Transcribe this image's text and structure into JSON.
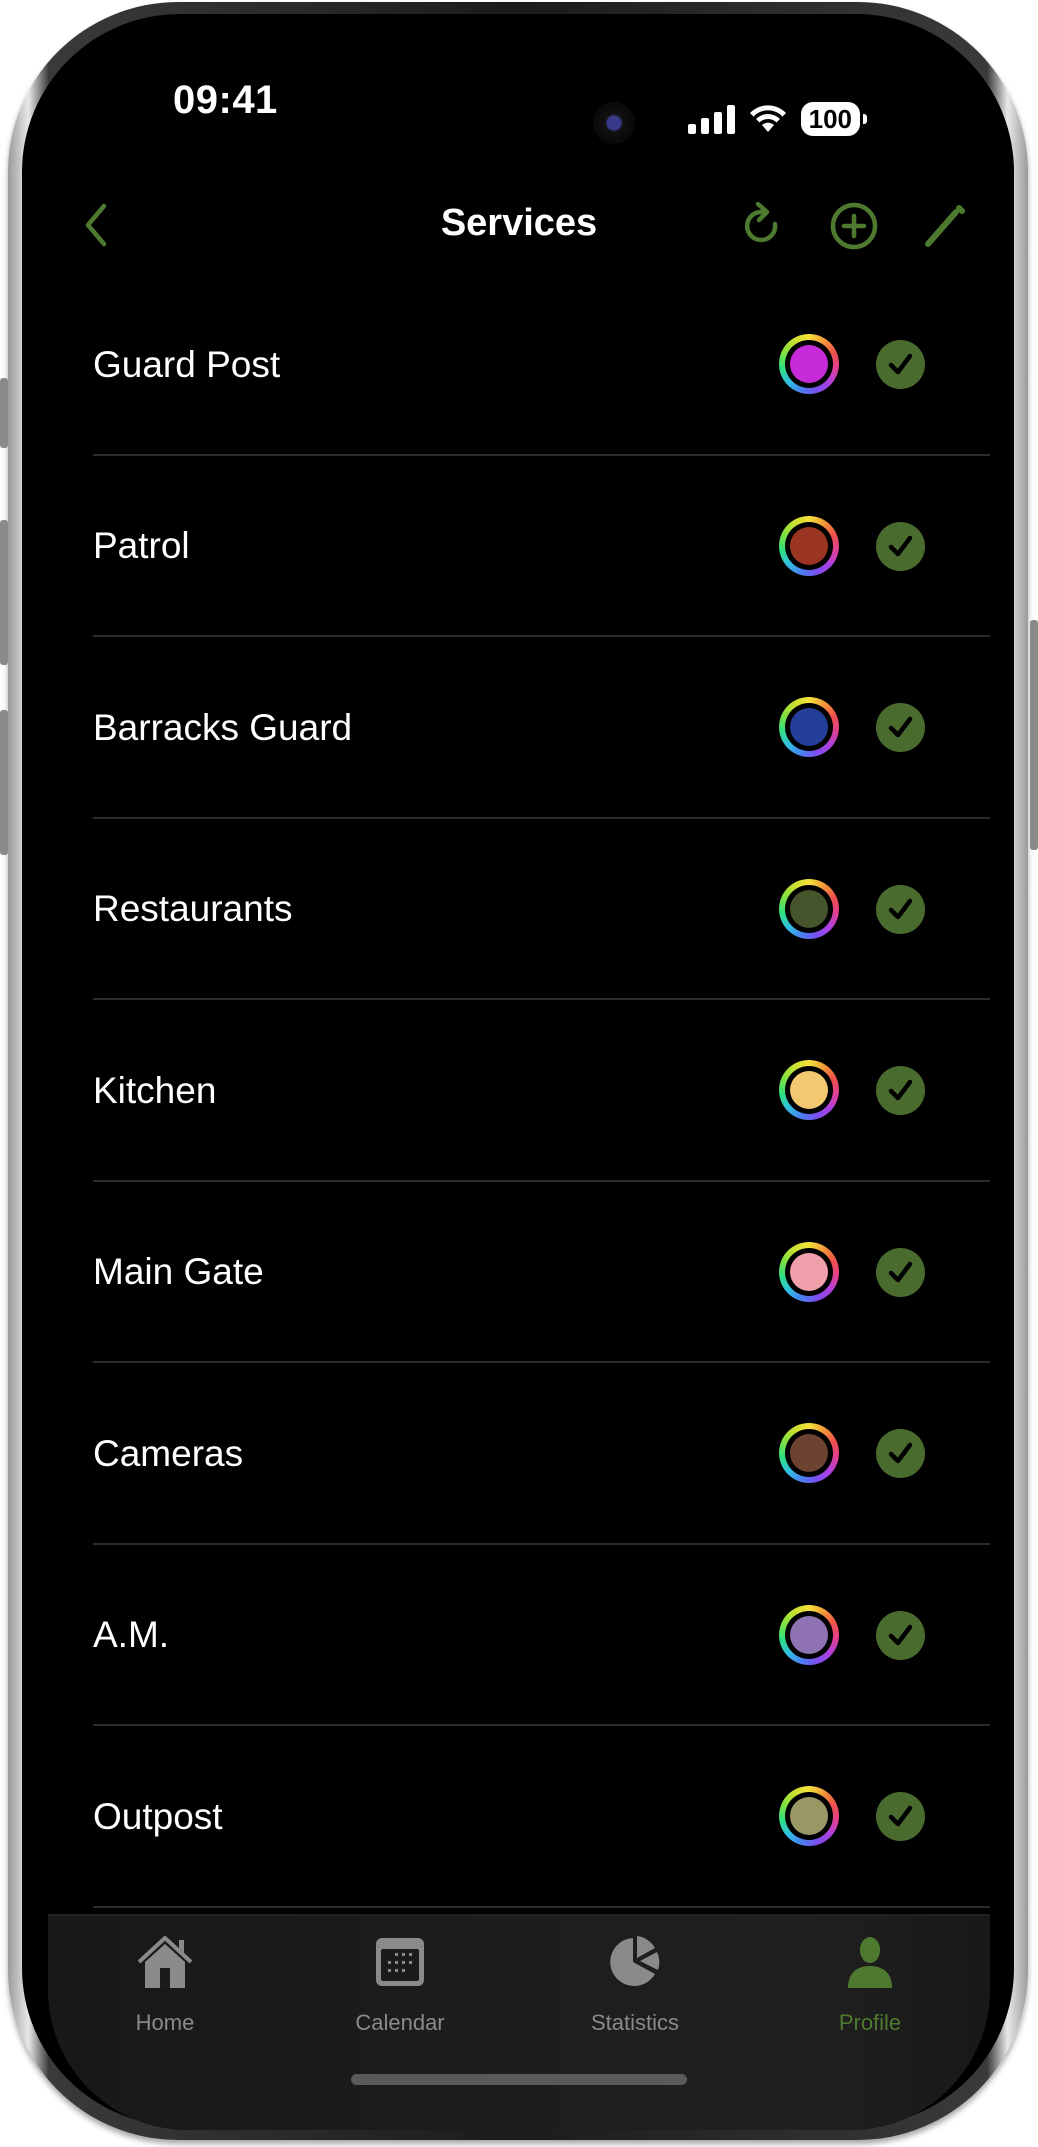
{
  "status_bar": {
    "time": "09:41",
    "battery": "100"
  },
  "nav": {
    "title": "Services",
    "back_icon": "chevron-left-icon",
    "actions": [
      {
        "name": "refresh",
        "icon": "refresh-icon"
      },
      {
        "name": "add",
        "icon": "plus-circle-icon"
      },
      {
        "name": "edit",
        "icon": "pencil-icon"
      }
    ]
  },
  "accent_color": "#4e7a2f",
  "services": [
    {
      "name": "Guard Post",
      "color": "#c62bd9",
      "enabled": true
    },
    {
      "name": "Patrol",
      "color": "#9a3521",
      "enabled": true
    },
    {
      "name": "Barracks Guard",
      "color": "#233f99",
      "enabled": true
    },
    {
      "name": "Restaurants",
      "color": "#45542b",
      "enabled": true
    },
    {
      "name": "Kitchen",
      "color": "#f2c871",
      "enabled": true
    },
    {
      "name": "Main Gate",
      "color": "#f0a0ab",
      "enabled": true
    },
    {
      "name": "Cameras",
      "color": "#6b4330",
      "enabled": true
    },
    {
      "name": "A.M.",
      "color": "#8e72b2",
      "enabled": true
    },
    {
      "name": "Outpost",
      "color": "#9a9766",
      "enabled": true
    }
  ],
  "tabbar": {
    "tabs": [
      {
        "label": "Home",
        "icon": "home-icon",
        "active": false
      },
      {
        "label": "Calendar",
        "icon": "calendar-icon",
        "active": false
      },
      {
        "label": "Statistics",
        "icon": "pie-chart-icon",
        "active": false
      },
      {
        "label": "Profile",
        "icon": "person-icon",
        "active": true
      }
    ]
  }
}
